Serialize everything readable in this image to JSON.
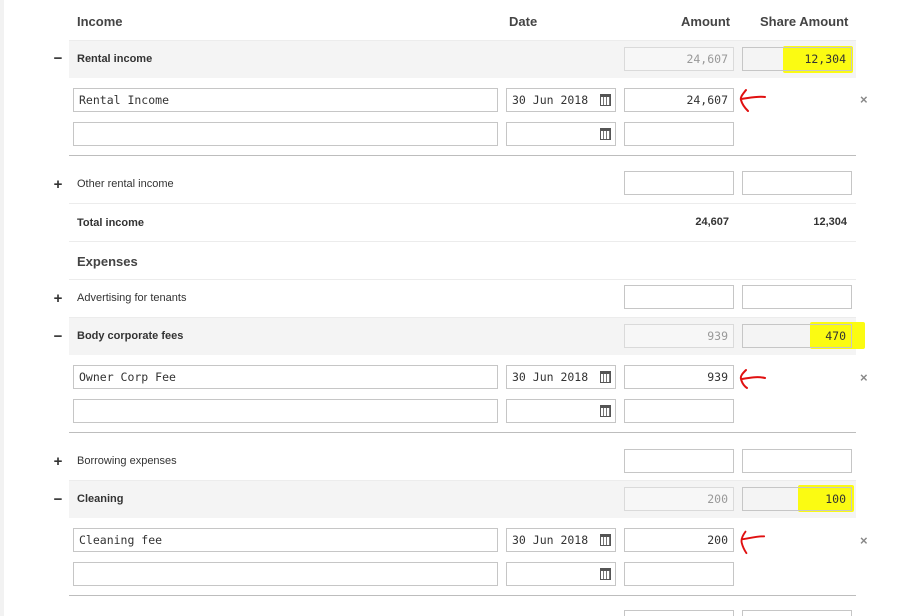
{
  "headers": {
    "income": "Income",
    "date": "Date",
    "amount": "Amount",
    "share": "Share Amount"
  },
  "rental_income": {
    "toggle": "−",
    "label": "Rental income",
    "amount": "24,607",
    "share": "12,304",
    "entry": {
      "description": "Rental Income",
      "date": "30 Jun 2018",
      "amount": "24,607"
    }
  },
  "other_rental_income": {
    "toggle": "+",
    "label": "Other rental income"
  },
  "total_income": {
    "label": "Total income",
    "amount": "24,607",
    "share": "12,304"
  },
  "expenses_heading": "Expenses",
  "advertising": {
    "toggle": "+",
    "label": "Advertising for tenants"
  },
  "body_corporate": {
    "toggle": "−",
    "label": "Body corporate fees",
    "amount": "939",
    "share": "470",
    "entry": {
      "description": "Owner Corp Fee",
      "date": "30 Jun 2018",
      "amount": "939"
    }
  },
  "borrowing": {
    "toggle": "+",
    "label": "Borrowing expenses"
  },
  "cleaning": {
    "toggle": "−",
    "label": "Cleaning",
    "amount": "200",
    "share": "100",
    "entry": {
      "description": "Cleaning fee",
      "date": "30 Jun 2018",
      "amount": "200"
    }
  },
  "remove_icon": "×",
  "colors": {
    "highlight": "#fbfb12",
    "annotation_arrow": "#e01010"
  }
}
